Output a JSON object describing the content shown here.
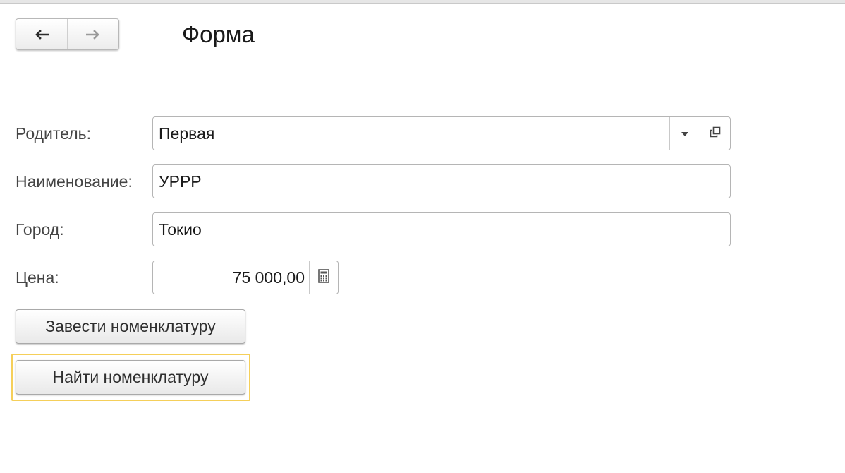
{
  "header": {
    "back_icon": "arrow-left-icon",
    "forward_icon": "arrow-right-icon",
    "title": "Форма"
  },
  "form": {
    "parent": {
      "label": "Родитель:",
      "value": "Первая"
    },
    "name": {
      "label": "Наименование:",
      "value": "УРРР"
    },
    "city": {
      "label": "Город:",
      "value": "Токио"
    },
    "price": {
      "label": "Цена:",
      "value": "75 000,00"
    }
  },
  "buttons": {
    "create_label": "Завести номенклатуру",
    "find_label": "Найти номенклатуру"
  },
  "colors": {
    "focus_ring": "#f5cf5a"
  }
}
